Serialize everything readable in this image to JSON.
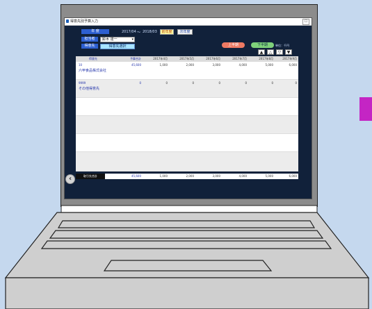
{
  "window": {
    "title": "得意先別予算入力"
  },
  "filters": {
    "period_label": "年 度",
    "period_from": "2017/04",
    "period_sep": "〜",
    "period_to": "2018/03",
    "this_year_btn": "前年度",
    "next_year_btn": "次年度",
    "manager_label": "担当者",
    "manager_value": "鈴木 達一",
    "customer_label": "得意先",
    "customer_btn": "得意先選択"
  },
  "toolbar": {
    "first_half": "上半期",
    "second_half": "下半期",
    "unit": "単位：千円",
    "nav_first": "▲",
    "nav_up": "△",
    "nav_down": "▽",
    "nav_last": "▼"
  },
  "grid": {
    "headers": [
      "得意先",
      "予算合計",
      "2017年4月",
      "2017年5月",
      "2017年6月",
      "2017年7月",
      "2017年8月",
      "2017年9月"
    ],
    "rows": [
      {
        "code": "10",
        "name": "六甲食品株式会社",
        "total": "45,600",
        "months": [
          "1,000",
          "2,000",
          "3,000",
          "4,000",
          "5,000",
          "6,000"
        ]
      },
      {
        "code": "9999",
        "name": "その他得意先",
        "total": "0",
        "months": [
          "0",
          "0",
          "0",
          "0",
          "0",
          "0"
        ]
      }
    ]
  },
  "totals": {
    "label": "取引先合計",
    "total": "45,600",
    "months": [
      "1,000",
      "2,000",
      "3,000",
      "4,000",
      "5,000",
      "6,000"
    ]
  },
  "colors": {
    "accent_blue": "#2d5fd0",
    "app_bg": "#11213a",
    "marker": "#c425c4"
  },
  "icons": {
    "back": "arrow-left-circle-icon",
    "app": "app-icon"
  }
}
